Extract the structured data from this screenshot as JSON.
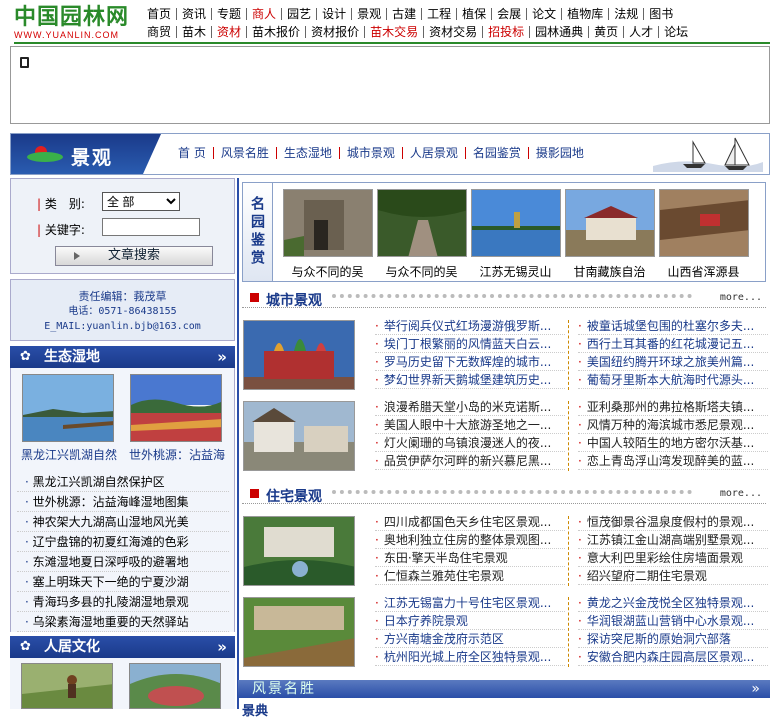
{
  "logo": {
    "main": "中国园林网",
    "url": "WWW.YUANLIN.COM"
  },
  "topnav": {
    "row1": [
      {
        "label": "首页",
        "red": false
      },
      {
        "label": "资讯",
        "red": false
      },
      {
        "label": "专题",
        "red": false
      },
      {
        "label": "商人",
        "red": true
      },
      {
        "label": "园艺",
        "red": false
      },
      {
        "label": "设计",
        "red": false
      },
      {
        "label": "景观",
        "red": false
      },
      {
        "label": "古建",
        "red": false
      },
      {
        "label": "工程",
        "red": false
      },
      {
        "label": "植保",
        "red": false
      },
      {
        "label": "会展",
        "red": false
      },
      {
        "label": "论文",
        "red": false
      },
      {
        "label": "植物库",
        "red": false
      },
      {
        "label": "法规",
        "red": false
      },
      {
        "label": "图书",
        "red": false
      }
    ],
    "row2": [
      {
        "label": "商贸",
        "red": false
      },
      {
        "label": "苗木",
        "red": false
      },
      {
        "label": "资材",
        "red": true
      },
      {
        "label": "苗木报价",
        "red": false
      },
      {
        "label": "资材报价",
        "red": false
      },
      {
        "label": "苗木交易",
        "red": true
      },
      {
        "label": "资材交易",
        "red": false
      },
      {
        "label": "招投标",
        "red": true
      },
      {
        "label": "园林通典",
        "red": false
      },
      {
        "label": "黄页",
        "red": false
      },
      {
        "label": "人才",
        "red": false
      },
      {
        "label": "论坛",
        "red": false
      }
    ]
  },
  "banner": {
    "title": "景观",
    "nav": [
      "首 页",
      "风景名胜",
      "生态湿地",
      "城市景观",
      "人居景观",
      "名园鉴赏",
      "摄影园地"
    ]
  },
  "search": {
    "category_label": "类　别:",
    "category_value": "全 部",
    "keyword_label": "关键字:",
    "keyword_value": "",
    "button": "文章搜索"
  },
  "editor": {
    "line1": "责任编辑：莪茂草",
    "line2": "电话：0571-86438155",
    "line3": "E_MAIL:yuanlin.bjb@163.com"
  },
  "wetland": {
    "title": "生态湿地",
    "pics": [
      {
        "caption": "黑龙江兴凯湖自然"
      },
      {
        "caption": "世外桃源：沾益海"
      }
    ],
    "items": [
      "黑龙江兴凯湖自然保护区",
      "世外桃源：沾益海峰湿地图集",
      "神农架大九湖高山湿地风光美",
      "辽宁盘锦的初夏红海滩的色彩",
      "东滩湿地夏日深呼吸的避署地",
      "塞上明珠天下一绝的宁夏沙湖",
      "青海玛多县的扎陵湖湿地景观",
      "乌梁素海湿地重要的天然驿站"
    ]
  },
  "living": {
    "title": "人居文化"
  },
  "gallery": {
    "label": "名园鉴赏",
    "items": [
      {
        "caption": "与众不同的吴"
      },
      {
        "caption": "与众不同的吴"
      },
      {
        "caption": "江苏无锡灵山"
      },
      {
        "caption": "甘南藏族自治"
      },
      {
        "caption": "山西省浑源县"
      }
    ]
  },
  "city": {
    "title": "城市景观",
    "more": "more...",
    "group1_left": [
      "举行阅兵仪式红场漫游俄罗斯...",
      "埃门丁根繁丽的风情蓝天白云...",
      "罗马历史留下无数辉煌的城市...",
      "梦幻世界新天鹅城堡建筑历史..."
    ],
    "group1_right": [
      "被童话城堡包围的杜塞尔多夫...",
      "西行土耳其番的红花城漫记五...",
      "美国纽约腾开环球之旅美州篇...",
      "葡萄牙里斯本大航海时代源头..."
    ],
    "group2_left": [
      "浪漫希腊天堂小岛的米克诺斯...",
      "美国人眼中十大旅游圣地之一...",
      "灯火阑珊的乌镇浪漫迷人的夜...",
      "品赏伊萨尔河畔的新兴慕尼黑..."
    ],
    "group2_right": [
      "亚利桑那州的弗拉格斯塔夫镇...",
      "风情万种的海滨城市悉尼景观...",
      "中国人较陌生的地方密尔沃基...",
      "恋上青岛浮山湾发现醉美的蓝..."
    ]
  },
  "residential": {
    "title": "住宅景观",
    "more": "more...",
    "group1_left": [
      "四川成都国色天乡住宅区景观...",
      "奥地利独立住房的整体景观图...",
      "东田·擎天半岛住宅景观",
      "仁恒森兰雅苑住宅景观"
    ],
    "group1_right": [
      "恒茂御景谷温泉度假村的景观...",
      "江苏镇江金山湖高端别墅景观...",
      "意大利巴里彩绘住房墙面景观",
      "绍兴望府二期住宅景观"
    ],
    "group2_left": [
      "江苏无锡富力十号住宅区景观...",
      "日本疗养院景观",
      "方兴南塘金茂府示范区",
      "杭州阳光城上府全区独特景观..."
    ],
    "group2_right": [
      "黄龙之兴金茂悦全区独特景观...",
      "华润银湖蓝山营销中心水景观...",
      "探访突尼斯的原始洞穴部落",
      "安徽合肥内森庄园高层区景观..."
    ]
  },
  "scenic": {
    "title": "风景名胜",
    "sub": "景典"
  }
}
